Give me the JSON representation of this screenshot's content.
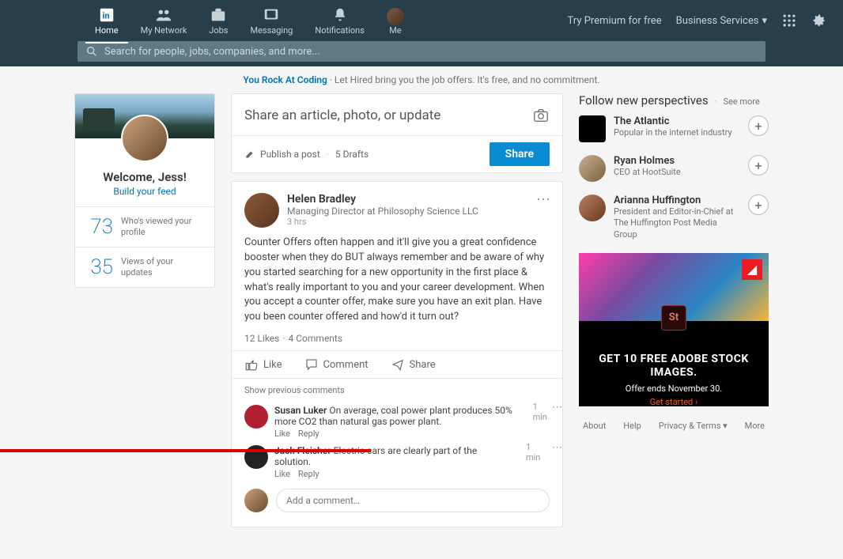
{
  "nav": {
    "items": [
      {
        "label": "Home"
      },
      {
        "label": "My Network"
      },
      {
        "label": "Jobs"
      },
      {
        "label": "Messaging"
      },
      {
        "label": "Notifications"
      },
      {
        "label": "Me"
      }
    ],
    "premium": "Try Premium for free",
    "business": "Business Services"
  },
  "search": {
    "placeholder": "Search for people, jobs, companies, and more..."
  },
  "promo": {
    "link": "You Rock At Coding",
    "text": " · Let Hired bring you the job offers. It's free, and no commitment."
  },
  "profile": {
    "welcome": "Welcome, Jess!",
    "build": "Build your feed",
    "stats": [
      {
        "num": "73",
        "label": "Who's viewed your profile"
      },
      {
        "num": "35",
        "label": "Views of your updates"
      }
    ]
  },
  "share": {
    "prompt": "Share an article, photo, or update",
    "publish": "Publish a post",
    "drafts": "5 Drafts",
    "button": "Share"
  },
  "post": {
    "author": "Helen Bradley",
    "title": "Managing Director at Philosophy Science LLC",
    "time": "3 hrs",
    "body": "Counter Offers often happen and it'll give you a great confidence booster when they do BUT always remember and be aware of why you started searching for a new opportunity in the first place & what's really important to you and your career development. When you accept a counter offer, make sure you have an exit plan. Have you been counter offered and how'd it turn out?",
    "likes": "12 Likes",
    "comments_count": "4 Comments",
    "actions": {
      "like": "Like",
      "comment": "Comment",
      "share": "Share"
    },
    "show_prev": "Show previous comments",
    "comments": [
      {
        "name": "Susan Luker",
        "text": "On average, coal power plant produces 50% more CO2 than natural gas power plant.",
        "time": "1 min",
        "like": "Like",
        "reply": "Reply",
        "avColor": "#b02030"
      },
      {
        "name": "Jack Fleisher",
        "text": "Electric cars are clearly part of the solution.",
        "time": "1 min",
        "like": "Like",
        "reply": "Reply",
        "avColor": "#222"
      }
    ],
    "add_placeholder": "Add a comment…"
  },
  "follow": {
    "heading": "Follow new perspectives",
    "see": "See more",
    "items": [
      {
        "name": "The Atlantic",
        "desc": "Popular in the internet industry",
        "square": true,
        "bg": "#000"
      },
      {
        "name": "Ryan Holmes",
        "desc": "CEO at HootSuite",
        "square": false,
        "bg": "linear-gradient(135deg,#c8b090,#7a6040)"
      },
      {
        "name": "Arianna Huffington",
        "desc": "President and Editor-in-Chief at The Huffington Post Media Group",
        "square": false,
        "bg": "linear-gradient(135deg,#b88060,#6a3a20)"
      }
    ]
  },
  "ad": {
    "logo_alt": "Adobe",
    "tile": "St",
    "line1": "GET 10 FREE ADOBE STOCK IMAGES.",
    "line2": "Offer ends November 30.",
    "cta": "Get started ›"
  },
  "footer": [
    "About",
    "Help",
    "Privacy & Terms ▾",
    "More"
  ]
}
